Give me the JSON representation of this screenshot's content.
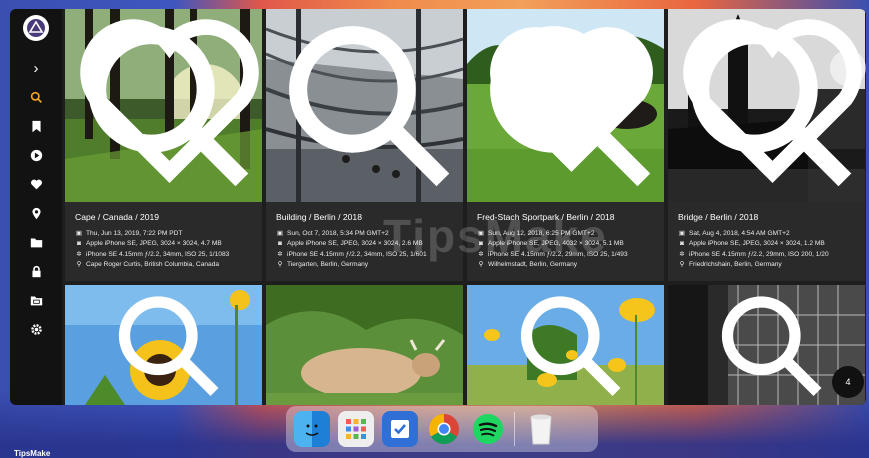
{
  "watermark": "TipsMake",
  "brand": "TipsMake",
  "sidebar": {
    "items": [
      {
        "icon": "chevron-right-icon",
        "glyph": "›"
      },
      {
        "icon": "search-icon",
        "active": true
      },
      {
        "icon": "bookmark-icon"
      },
      {
        "icon": "play-icon"
      },
      {
        "icon": "heart-icon"
      },
      {
        "icon": "location-pin-icon"
      },
      {
        "icon": "folder-icon"
      },
      {
        "icon": "lock-icon"
      },
      {
        "icon": "library-icon"
      },
      {
        "icon": "gear-icon"
      }
    ]
  },
  "cards": [
    {
      "title": "Cape / Canada / 2019",
      "date": "Thu, Jun 13, 2019, 7:22 PM PDT",
      "camera": "Apple iPhone SE, JPEG, 3024 × 3024, 4.7 MB",
      "lens": "iPhone SE 4.15mm ƒ/2.2, 34mm, ISO 25, 1/1083",
      "place": "Cape Roger Curtis, British Columbia, Canada"
    },
    {
      "title": "Building / Berlin / 2018",
      "date": "Sun, Oct 7, 2018, 5:34 PM GMT+2",
      "camera": "Apple iPhone SE, JPEG, 3024 × 3024, 2.6 MB",
      "lens": "iPhone SE 4.15mm ƒ/2.2, 34mm, ISO 25, 1/601",
      "place": "Tiergarten, Berlin, Germany"
    },
    {
      "title": "Fred-Stach Sportpark / Berlin / 2018",
      "date": "Sun, Aug 12, 2018, 6:25 PM GMT+2",
      "camera": "Apple iPhone SE, JPEG, 4032 × 3024, 5.1 MB",
      "lens": "iPhone SE 4.15mm ƒ/2.2, 29mm, ISO 25, 1/493",
      "place": "Wilhelmstadt, Berlin, Germany"
    },
    {
      "title": "Bridge / Berlin / 2018",
      "date": "Sat, Aug 4, 2018, 4:54 AM GMT+2",
      "camera": "Apple iPhone SE, JPEG, 3024 × 3024, 1.2 MB",
      "lens": "iPhone SE 4.15mm ƒ/2.2, 29mm, ISO 200, 1/20",
      "place": "Friedrichshain, Berlin, Germany"
    }
  ],
  "count_badge": "4",
  "dock": {
    "apps": [
      "finder-icon",
      "launchpad-icon",
      "reminders-icon",
      "chrome-icon",
      "spotify-icon",
      "trash-icon"
    ]
  },
  "colors": {
    "accent": "#f5a623",
    "card_bg": "#2a2a2a",
    "sidebar_bg": "#121212"
  }
}
